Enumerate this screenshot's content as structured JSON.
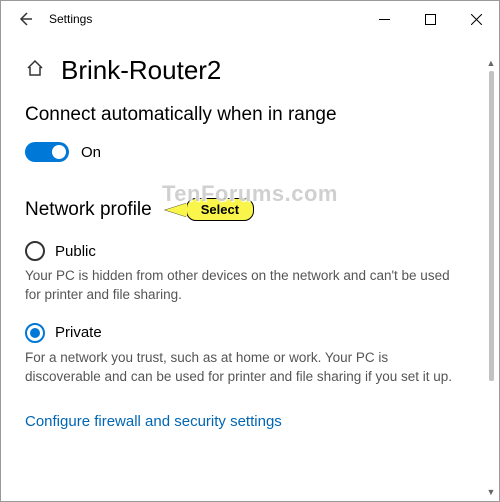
{
  "titlebar": {
    "title": "Settings"
  },
  "header": {
    "page_title": "Brink-Router2"
  },
  "auto_connect": {
    "heading": "Connect automatically when in range",
    "toggle_state": "On"
  },
  "network_profile": {
    "heading": "Network profile",
    "callout": "Select",
    "options": [
      {
        "label": "Public",
        "checked": false,
        "description": "Your PC is hidden from other devices on the network and can't be used for printer and file sharing."
      },
      {
        "label": "Private",
        "checked": true,
        "description": "For a network you trust, such as at home or work. Your PC is discoverable and can be used for printer and file sharing if you set it up."
      }
    ]
  },
  "link": {
    "label": "Configure firewall and security settings"
  },
  "watermark": "TenForums.com"
}
